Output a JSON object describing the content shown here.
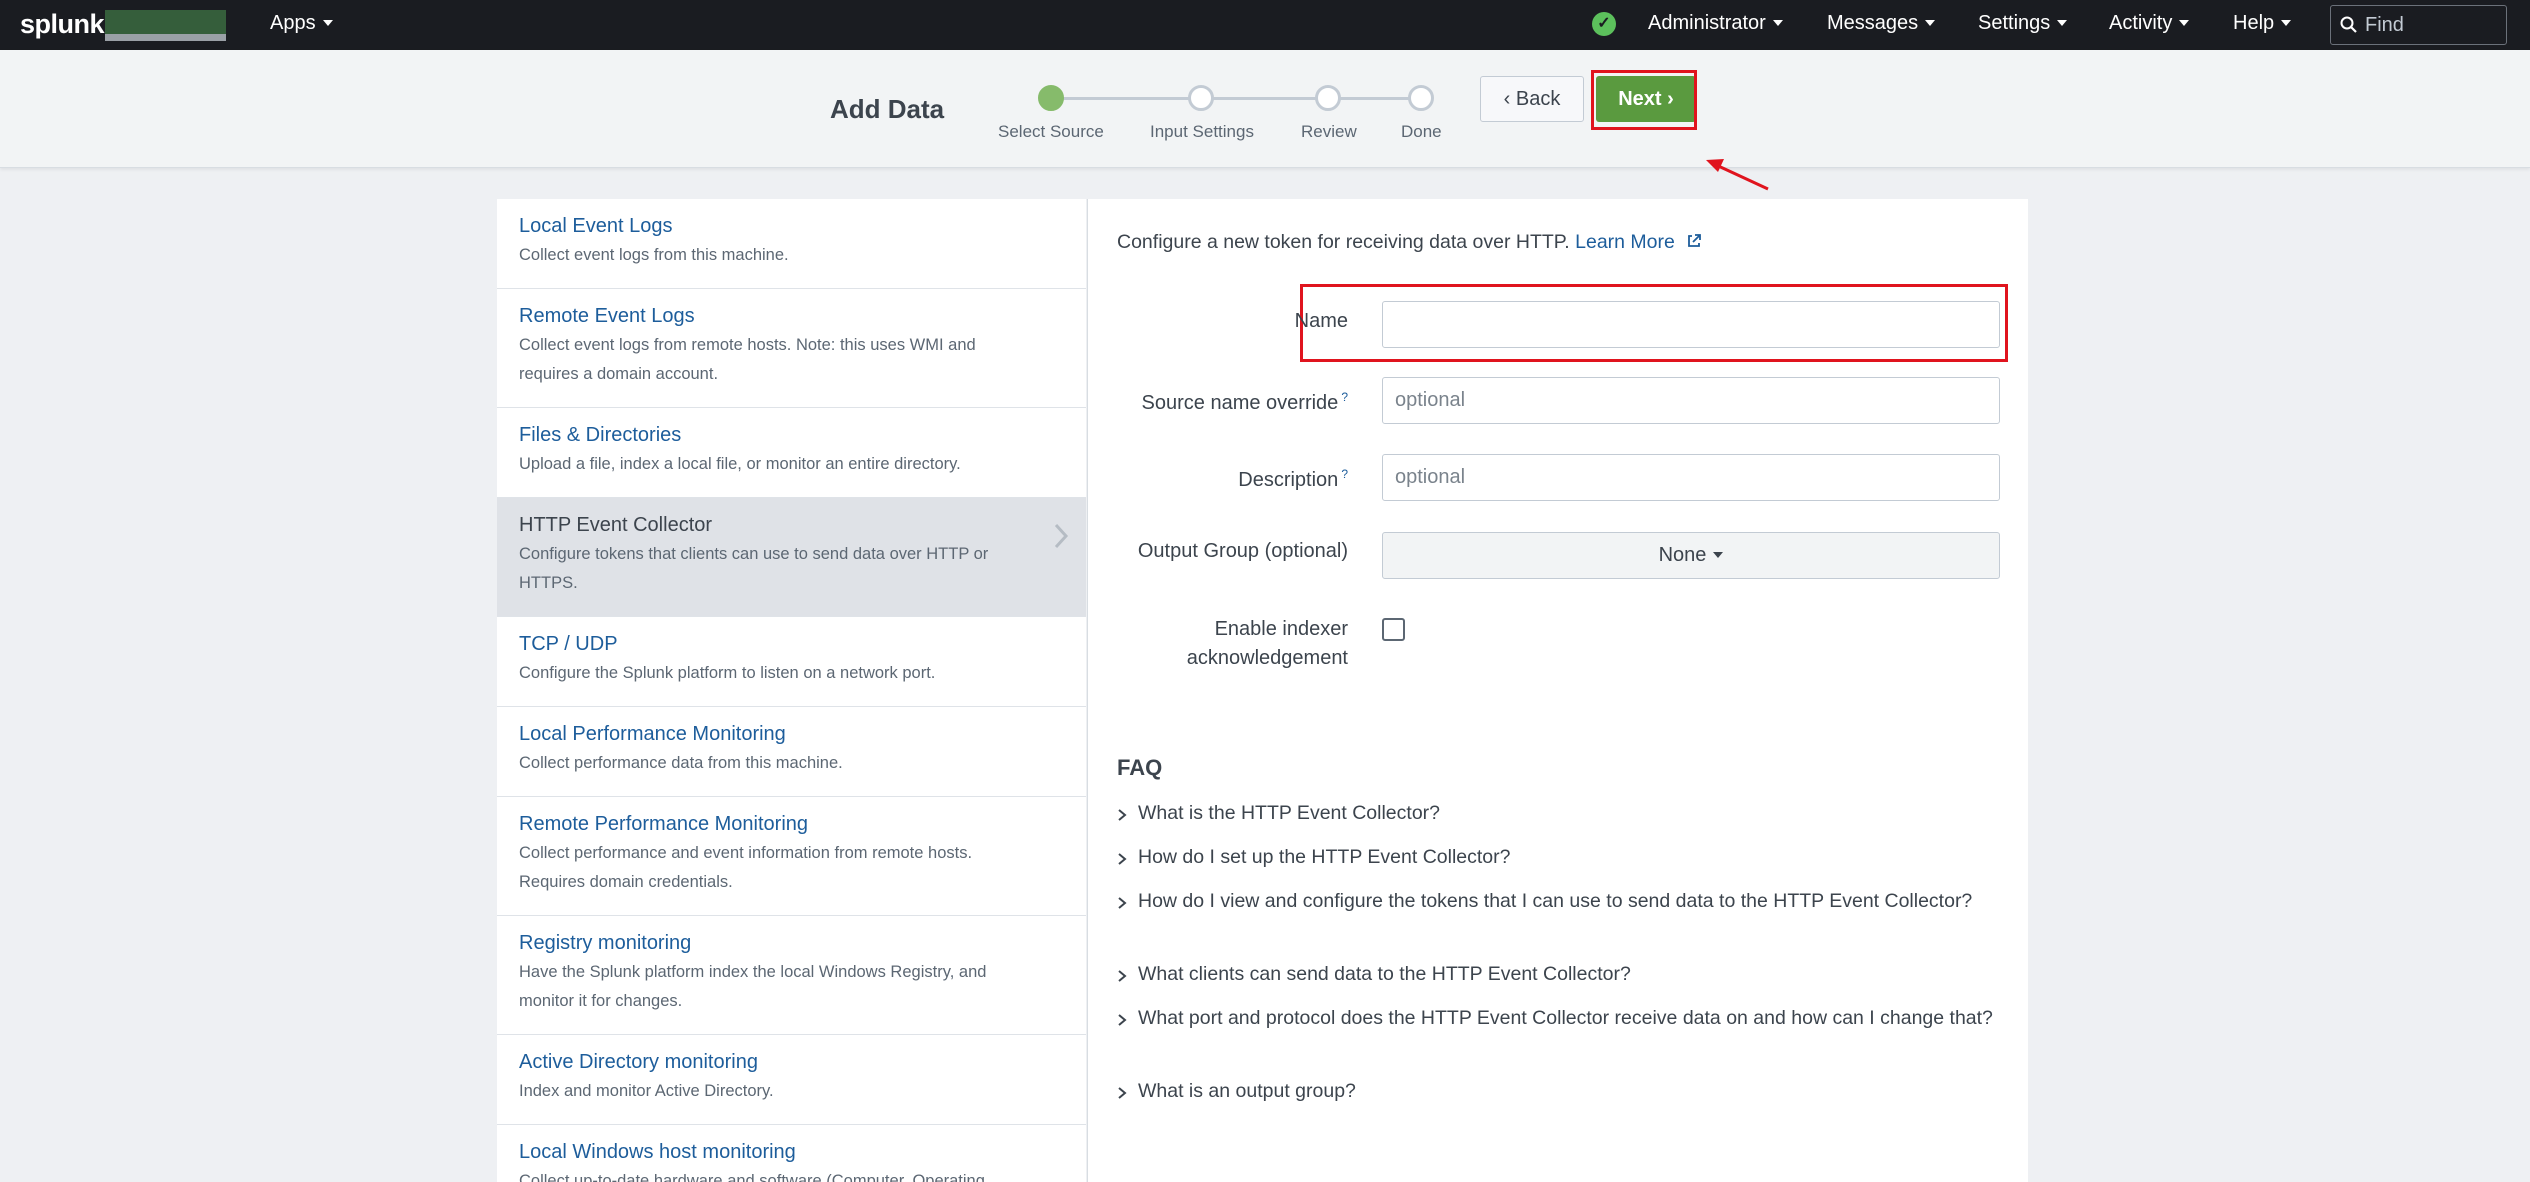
{
  "topbar": {
    "logo": "splunk>",
    "apps_label": "Apps",
    "admin_label": "Administrator",
    "messages_label": "Messages",
    "settings_label": "Settings",
    "activity_label": "Activity",
    "help_label": "Help",
    "find_placeholder": "Find",
    "status_color": "#5cc05c"
  },
  "header": {
    "title": "Add Data",
    "steps": [
      {
        "label": "Select Source",
        "state": "active"
      },
      {
        "label": "Input Settings",
        "state": "pending"
      },
      {
        "label": "Review",
        "state": "pending"
      },
      {
        "label": "Done",
        "state": "pending"
      }
    ],
    "back_label": "Back",
    "next_label": "Next"
  },
  "sources": [
    {
      "title": "Local Event Logs",
      "desc": "Collect event logs from this machine."
    },
    {
      "title": "Remote Event Logs",
      "desc": "Collect event logs from remote hosts. Note: this uses WMI and requires a domain account."
    },
    {
      "title": "Files & Directories",
      "desc": "Upload a file, index a local file, or monitor an entire directory."
    },
    {
      "title": "HTTP Event Collector",
      "desc": "Configure tokens that clients can use to send data over HTTP or HTTPS.",
      "selected": true
    },
    {
      "title": "TCP / UDP",
      "desc": "Configure the Splunk platform to listen on a network port."
    },
    {
      "title": "Local Performance Monitoring",
      "desc": "Collect performance data from this machine."
    },
    {
      "title": "Remote Performance Monitoring",
      "desc": "Collect performance and event information from remote hosts. Requires domain credentials."
    },
    {
      "title": "Registry monitoring",
      "desc": "Have the Splunk platform index the local Windows Registry, and monitor it for changes."
    },
    {
      "title": "Active Directory monitoring",
      "desc": "Index and monitor Active Directory."
    },
    {
      "title": "Local Windows host monitoring",
      "desc": "Collect up-to-date hardware and software (Computer, Operating"
    }
  ],
  "form": {
    "intro": "Configure a new token for receiving data over HTTP.",
    "learn_more": "Learn More",
    "name_label": "Name",
    "name_value": "",
    "source_label": "Source name override",
    "source_placeholder": "optional",
    "description_label": "Description",
    "description_placeholder": "optional",
    "help_mark": "?",
    "output_group_label": "Output Group (optional)",
    "output_group_value": "None",
    "indexer_ack_label_line1": "Enable indexer",
    "indexer_ack_label_line2": "acknowledgement",
    "indexer_ack_checked": false
  },
  "faq": {
    "title": "FAQ",
    "items": [
      "What is the HTTP Event Collector?",
      "How do I set up the HTTP Event Collector?",
      "How do I view and configure the tokens that I can use to send data to the HTTP Event Collector?",
      "What clients can send data to the HTTP Event Collector?",
      "What port and protocol does the HTTP Event Collector receive data on and how can I change that?",
      "What is an output group?"
    ]
  },
  "annotation_color": "#e0141e"
}
